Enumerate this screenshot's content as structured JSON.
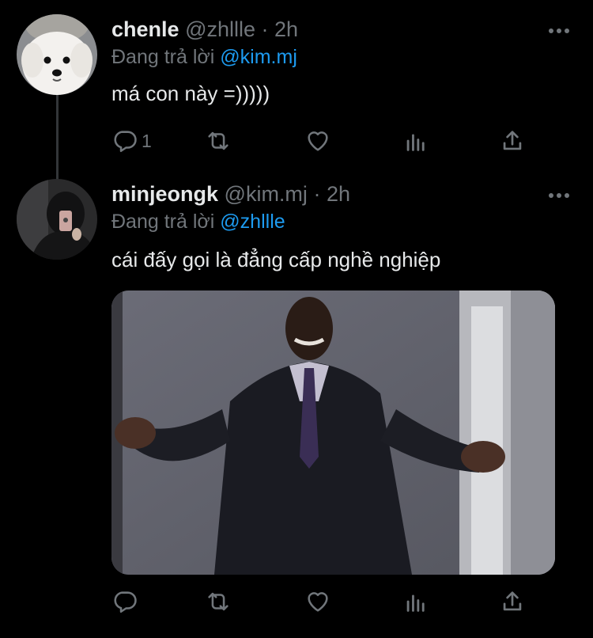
{
  "tweets": [
    {
      "name": "chenle",
      "handle": "@zhllle",
      "time": "2h",
      "replying_prefix": "Đang trả lời",
      "replying_to": "@kim.mj",
      "text": "má con này =)))))",
      "reply_count": "1",
      "avatar_icon": "white-dog-avatar"
    },
    {
      "name": "minjeongk",
      "handle": "@kim.mj",
      "time": "2h",
      "replying_prefix": "Đang trả lời",
      "replying_to": "@zhllle",
      "text": "cái đấy gọi là đẳng cấp nghề nghiệp",
      "reply_count": "",
      "avatar_icon": "mirror-selfie-avatar",
      "media_icon": "smiling-man-in-suit-meme-image"
    }
  ],
  "separator": "·",
  "colors": {
    "background": "#000000",
    "text": "#e7e9ea",
    "secondary": "#71767b",
    "accent": "#1d9bf0",
    "thread_line": "#333639"
  }
}
